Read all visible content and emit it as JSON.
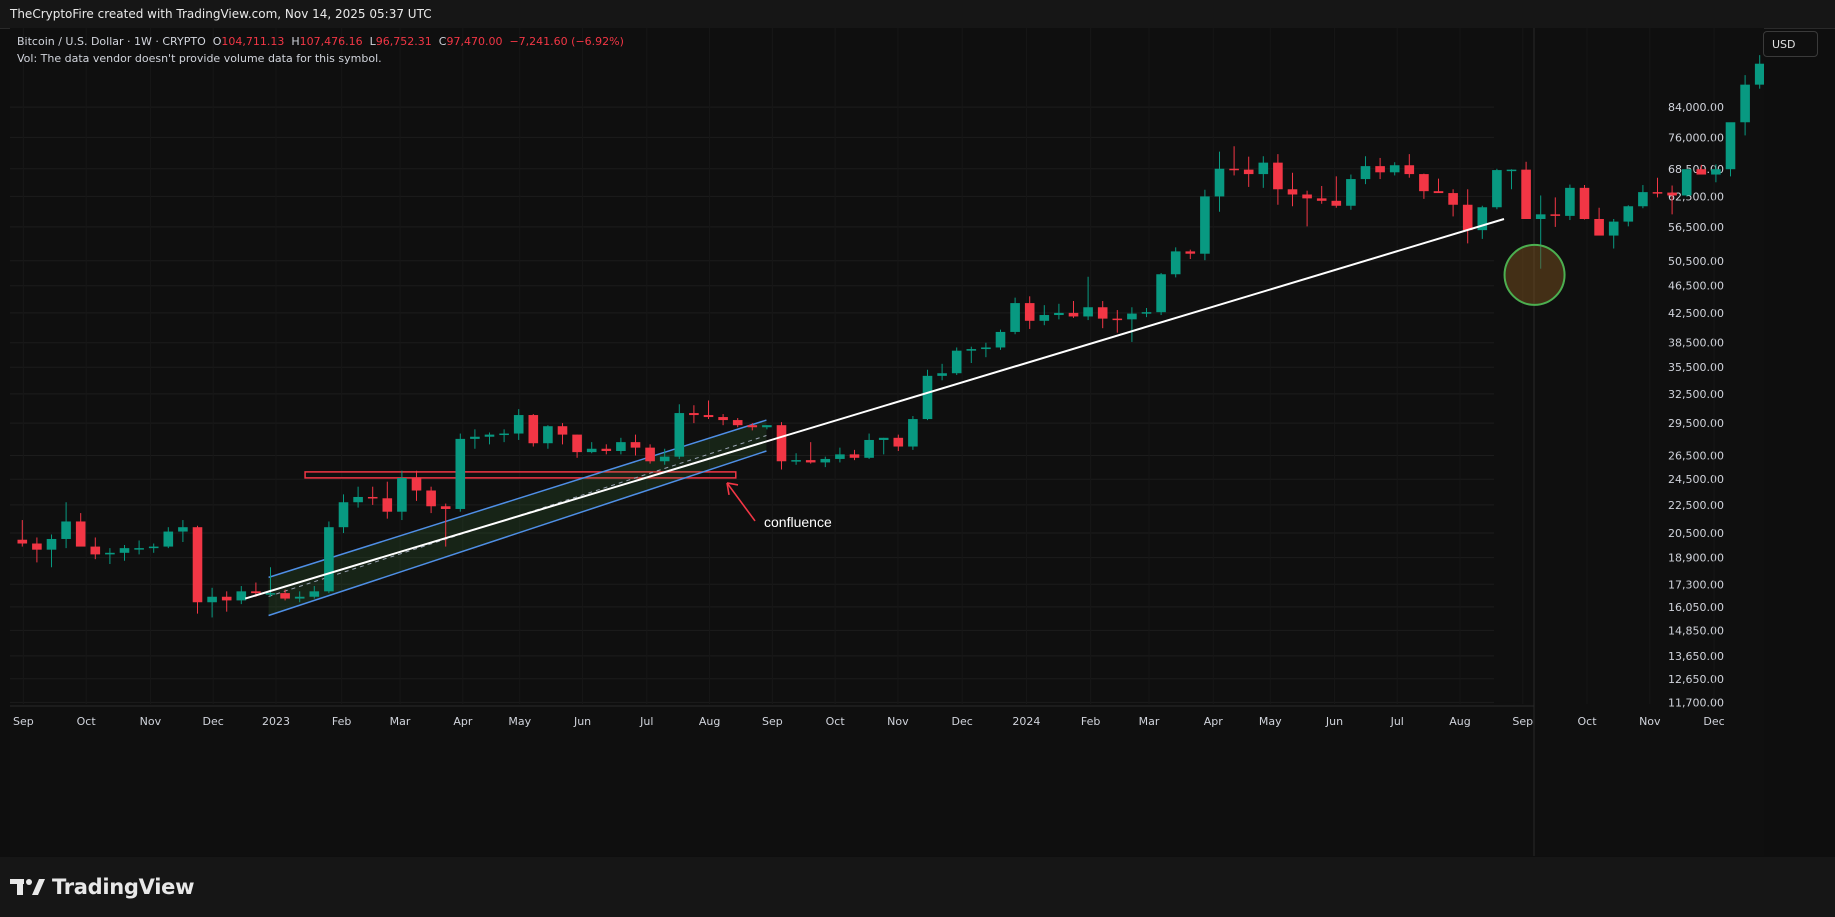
{
  "header": {
    "attribution": "TheCryptoFire created with TradingView.com, Nov 14, 2025 05:37 UTC"
  },
  "legend": {
    "symbol": "Bitcoin / U.S. Dollar · 1W · CRYPTO",
    "open_label": "O",
    "open": "104,711.13",
    "high_label": "H",
    "high": "107,476.16",
    "low_label": "L",
    "low": "96,752.31",
    "close_label": "C",
    "close": "97,470.00",
    "change": "−7,241.60 (−6.92%)",
    "volume_note": "Vol: The data vendor doesn't provide volume data for this symbol."
  },
  "currency_button": "USD",
  "annotation": {
    "text": "confluence"
  },
  "brand": "TradingView",
  "colors": {
    "up": "#089981",
    "down": "#f23645",
    "background": "#0f0f0f",
    "channel": "#4f8fe6",
    "trendline": "#ffffff",
    "zone": "#f23645",
    "circle": "#4caf50"
  },
  "chart_data": {
    "type": "candlestick",
    "interval": "1W",
    "y_scale": "log",
    "ylim": [
      11000,
      95000
    ],
    "price_axis_labels": [
      "84,000.00",
      "76,000.00",
      "68,500.00",
      "62,500.00",
      "56,500.00",
      "50,500.00",
      "46,500.00",
      "42,500.00",
      "38,500.00",
      "35,500.00",
      "32,500.00",
      "29,500.00",
      "26,500.00",
      "24,500.00",
      "22,500.00",
      "20,500.00",
      "18,900.00",
      "17,300.00",
      "16,050.00",
      "14,850.00",
      "13,650.00",
      "12,650.00",
      "11,700.00"
    ],
    "time_axis_labels": [
      "Sep",
      "Oct",
      "Nov",
      "Dec",
      "2023",
      "Feb",
      "Mar",
      "Apr",
      "May",
      "Jun",
      "Jul",
      "Aug",
      "Sep",
      "Oct",
      "Nov",
      "Dec",
      "2024",
      "Feb",
      "Mar",
      "Apr",
      "May",
      "Jun",
      "Jul",
      "Aug",
      "Sep",
      "Oct",
      "Nov",
      "Dec"
    ],
    "start_week": "2022-08-29",
    "candles": [
      [
        20050,
        21400,
        19600,
        19800
      ],
      [
        19800,
        20200,
        18600,
        19400
      ],
      [
        19400,
        20400,
        18300,
        20100
      ],
      [
        20100,
        22700,
        19500,
        21300
      ],
      [
        21300,
        21900,
        19800,
        19600
      ],
      [
        19600,
        20200,
        18800,
        19100
      ],
      [
        19100,
        19500,
        18500,
        19200
      ],
      [
        19200,
        19700,
        18700,
        19500
      ],
      [
        19500,
        20000,
        19100,
        19500
      ],
      [
        19500,
        19800,
        19200,
        19600
      ],
      [
        19600,
        20900,
        19500,
        20600
      ],
      [
        20600,
        21400,
        19900,
        20900
      ],
      [
        20900,
        21000,
        15700,
        16300
      ],
      [
        16300,
        17100,
        15500,
        16600
      ],
      [
        16600,
        16900,
        15800,
        16400
      ],
      [
        16400,
        17200,
        16200,
        16900
      ],
      [
        16900,
        17400,
        16600,
        16800
      ],
      [
        16800,
        18300,
        16600,
        16800
      ],
      [
        16800,
        17000,
        16400,
        16500
      ],
      [
        16500,
        16900,
        16300,
        16600
      ],
      [
        16600,
        17200,
        16500,
        16900
      ],
      [
        16900,
        21300,
        16800,
        20900
      ],
      [
        20900,
        23300,
        20500,
        22700
      ],
      [
        22700,
        23900,
        22300,
        23100
      ],
      [
        23100,
        23900,
        22500,
        23000
      ],
      [
        23000,
        24300,
        21500,
        22000
      ],
      [
        22000,
        25200,
        21400,
        24600
      ],
      [
        24600,
        25200,
        22800,
        23600
      ],
      [
        23600,
        23900,
        21900,
        22400
      ],
      [
        22400,
        22600,
        19600,
        22200
      ],
      [
        22200,
        28500,
        22000,
        28000
      ],
      [
        28000,
        28900,
        27100,
        28200
      ],
      [
        28200,
        28600,
        27500,
        28400
      ],
      [
        28400,
        28900,
        27700,
        28500
      ],
      [
        28500,
        30900,
        27900,
        30300
      ],
      [
        30300,
        30400,
        27300,
        27600
      ],
      [
        27600,
        29300,
        27100,
        29200
      ],
      [
        29200,
        29500,
        27500,
        28400
      ],
      [
        28400,
        28400,
        26300,
        26800
      ],
      [
        26800,
        27700,
        26700,
        27100
      ],
      [
        27100,
        27500,
        26600,
        26900
      ],
      [
        26900,
        28100,
        26600,
        27700
      ],
      [
        27700,
        28400,
        26500,
        27200
      ],
      [
        27200,
        27500,
        25800,
        26000
      ],
      [
        26000,
        27100,
        25700,
        26400
      ],
      [
        26400,
        31400,
        26200,
        30500
      ],
      [
        30500,
        31300,
        29500,
        30300
      ],
      [
        30300,
        31800,
        29900,
        30100
      ],
      [
        30100,
        30400,
        29300,
        29800
      ],
      [
        29800,
        30000,
        29100,
        29300
      ],
      [
        29300,
        29500,
        28800,
        29100
      ],
      [
        29100,
        29300,
        28900,
        29300
      ],
      [
        29300,
        29600,
        25300,
        26000
      ],
      [
        26000,
        26700,
        25700,
        26100
      ],
      [
        26100,
        27700,
        25800,
        25900
      ],
      [
        25900,
        26400,
        25500,
        26200
      ],
      [
        26200,
        27200,
        25900,
        26600
      ],
      [
        26600,
        27000,
        26100,
        26300
      ],
      [
        26300,
        28500,
        26200,
        27900
      ],
      [
        27900,
        28100,
        26600,
        28100
      ],
      [
        28100,
        28400,
        26900,
        27300
      ],
      [
        27300,
        30200,
        27000,
        29900
      ],
      [
        29900,
        35200,
        29800,
        34500
      ],
      [
        34500,
        35900,
        34000,
        34800
      ],
      [
        34800,
        37900,
        34600,
        37500
      ],
      [
        37500,
        38000,
        36000,
        37700
      ],
      [
        37700,
        38500,
        36700,
        37900
      ],
      [
        37900,
        40200,
        37600,
        39900
      ],
      [
        39900,
        44700,
        39600,
        43900
      ],
      [
        43900,
        44900,
        40300,
        41400
      ],
      [
        41400,
        43600,
        40800,
        42200
      ],
      [
        42200,
        43800,
        41600,
        42500
      ],
      [
        42500,
        44200,
        41800,
        42000
      ],
      [
        42000,
        47900,
        41500,
        43300
      ],
      [
        43300,
        44200,
        40400,
        41700
      ],
      [
        41700,
        42900,
        39800,
        41600
      ],
      [
        41600,
        43300,
        38600,
        42400
      ],
      [
        42400,
        43200,
        41900,
        42600
      ],
      [
        42600,
        48500,
        42200,
        48300
      ],
      [
        48300,
        52800,
        47800,
        52100
      ],
      [
        52100,
        52400,
        50800,
        51700
      ],
      [
        51700,
        63900,
        50600,
        62500
      ],
      [
        62500,
        72500,
        59400,
        68500
      ],
      [
        68500,
        73800,
        67000,
        68300
      ],
      [
        68300,
        71300,
        64500,
        67300
      ],
      [
        67300,
        71400,
        64300,
        69900
      ],
      [
        69900,
        71900,
        60800,
        64000
      ],
      [
        64000,
        67600,
        60500,
        62900
      ],
      [
        62900,
        63700,
        56600,
        62100
      ],
      [
        62100,
        64700,
        61000,
        61600
      ],
      [
        61600,
        66800,
        60200,
        60600
      ],
      [
        60600,
        67200,
        59800,
        66200
      ],
      [
        66200,
        71400,
        65100,
        69100
      ],
      [
        69100,
        71000,
        66200,
        67700
      ],
      [
        67700,
        70000,
        67000,
        69300
      ],
      [
        69300,
        71900,
        66500,
        67300
      ],
      [
        67300,
        67400,
        62000,
        63600
      ],
      [
        63600,
        66300,
        63300,
        63200
      ],
      [
        63200,
        64000,
        58500,
        60800
      ],
      [
        60800,
        64000,
        53500,
        55900
      ],
      [
        55900,
        60600,
        54300,
        60300
      ],
      [
        60300,
        68500,
        59900,
        68200
      ],
      [
        68200,
        68400,
        64000,
        68300
      ],
      [
        68300,
        70100,
        60100,
        58000
      ],
      [
        58000,
        62700,
        49200,
        58900
      ],
      [
        58900,
        62300,
        56500,
        58600
      ],
      [
        58600,
        65000,
        57800,
        64300
      ],
      [
        64300,
        64900,
        57900,
        58000
      ],
      [
        58000,
        60200,
        57200,
        54900
      ],
      [
        54900,
        58000,
        52600,
        57500
      ],
      [
        57500,
        60700,
        56600,
        60500
      ],
      [
        60500,
        64900,
        60100,
        63400
      ],
      [
        63400,
        66500,
        62300,
        63300
      ],
      [
        63300,
        64800,
        58900,
        62700
      ],
      [
        62700,
        68400,
        62500,
        68400
      ],
      [
        68400,
        69400,
        67500,
        67200
      ],
      [
        67200,
        69500,
        65500,
        68400
      ],
      [
        68400,
        73600,
        66800,
        79900
      ],
      [
        79900,
        93400,
        76500,
        90500
      ],
      [
        90500,
        99800,
        89300,
        97000
      ],
      [
        97000,
        100000,
        95000,
        95300
      ],
      [
        95300,
        99000,
        92800,
        97500
      ]
    ],
    "channel": {
      "from": "Jan 2023",
      "to": "Oct 2023",
      "style": "parallel channel"
    },
    "trendline": {
      "from": "Jan 2023",
      "to": "Dec 2024"
    },
    "zone": {
      "price_low": 24700,
      "price_high": 25100,
      "from": "Feb 2023",
      "to": "Oct 2023"
    }
  }
}
